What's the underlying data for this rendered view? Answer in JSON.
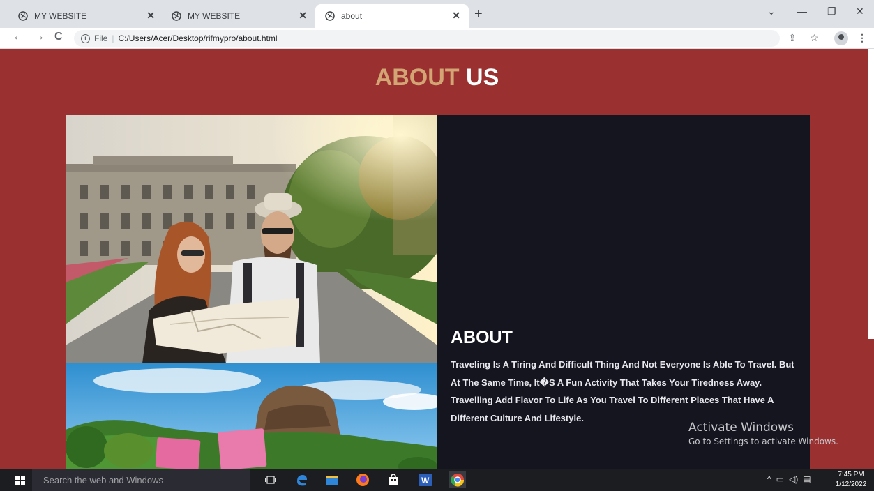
{
  "browser": {
    "tabs": [
      {
        "title": "MY WEBSITE",
        "active": false
      },
      {
        "title": "MY WEBSITE",
        "active": false
      },
      {
        "title": "about",
        "active": true
      }
    ],
    "new_tab": "+",
    "address": {
      "scheme_label": "File",
      "path": "C:/Users/Acer/Desktop/rifmypro/about.html"
    }
  },
  "page": {
    "heading_accent": "ABOUT",
    "heading_main": "US",
    "about_title": "ABOUT",
    "about_text": "Traveling Is A Tiring And Difficult Thing And Not Everyone Is Able To Travel. But At The Same Time, It�S A Fun Activity That Takes Your Tiredness Away. Travelling Add Flavor To Life As You Travel To Different Places That Have A Different Culture And Lifestyle.",
    "photo_top": "couple-with-map-photo",
    "photo_bottom": "sigiriya-rock-photo"
  },
  "watermark": {
    "title": "Activate Windows",
    "subtitle": "Go to Settings to activate Windows."
  },
  "taskbar": {
    "search_placeholder": "Search the web and Windows",
    "time": "7:45 PM",
    "date": "1/12/2022"
  },
  "colors": {
    "page_background": "#9a3030",
    "heading_accent": "#d4a574",
    "panel_background": "#14151f"
  }
}
